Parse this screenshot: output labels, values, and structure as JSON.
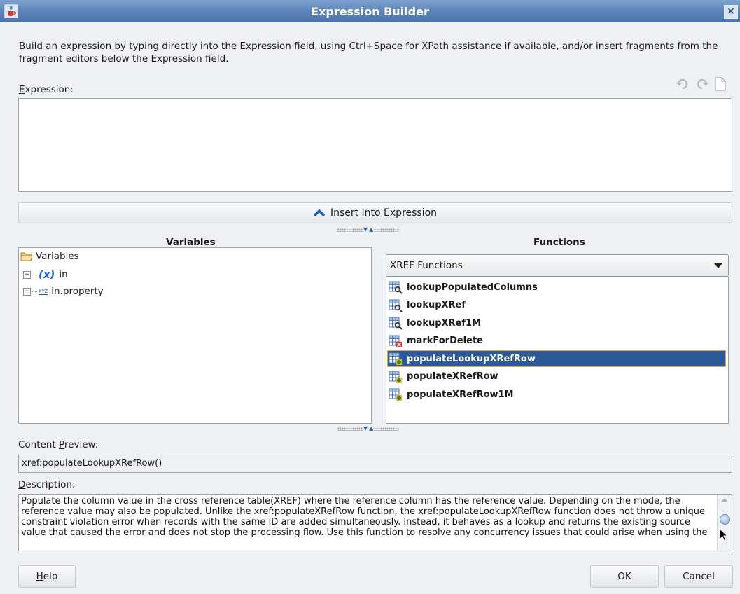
{
  "window": {
    "title": "Expression Builder",
    "close_glyph": "×",
    "app_icon": "java-cup-icon"
  },
  "instructions": "Build an expression by typing directly into the Expression field, using Ctrl+Space for XPath assistance if available, and/or insert fragments from the fragment editors below the Expression field.",
  "expression": {
    "label_mnemonic": "E",
    "label_rest": "xpression:",
    "value": "",
    "tools": [
      "undo-icon",
      "redo-icon",
      "clear-icon"
    ]
  },
  "insert_button": {
    "label": "Insert Into Expression",
    "icon": "chevron-up-icon"
  },
  "variables": {
    "heading": "Variables",
    "tree": [
      {
        "label": "Variables",
        "icon": "folder-icon"
      },
      {
        "label": "in",
        "icon_text": "(x)"
      },
      {
        "label": "in.property",
        "icon_text": "XYZ"
      }
    ]
  },
  "functions": {
    "heading": "Functions",
    "category": "XREF Functions",
    "items": [
      {
        "label": "lookupPopulatedColumns"
      },
      {
        "label": "lookupXRef"
      },
      {
        "label": "lookupXRef1M"
      },
      {
        "label": "markForDelete"
      },
      {
        "label": "populateLookupXRefRow",
        "selected": true
      },
      {
        "label": "populateXRefRow"
      },
      {
        "label": "populateXRefRow1M"
      }
    ]
  },
  "content_preview": {
    "label_before": "Content ",
    "label_mnemonic": "P",
    "label_rest": "review:",
    "value": "xref:populateLookupXRefRow()"
  },
  "description": {
    "label_mnemonic": "D",
    "label_rest": "escription:",
    "text": "Populate the column value in the cross reference table(XREF) where the reference column has the reference value. Depending on the mode, the reference value may also be populated. Unlike the xref:populateXRefRow function, the xref:populateLookupXRefRow function does not throw a unique constraint violation error when records with the same ID are added simultaneously. Instead, it behaves as a lookup and returns the existing source value that caused the error and does not stop the processing flow. Use this function to resolve any concurrency issues that could arise when using the"
  },
  "buttons": {
    "help_mnemonic": "H",
    "help_rest": "elp",
    "ok": "OK",
    "cancel": "Cancel"
  },
  "colors": {
    "titlebar": "#5a82b8",
    "selection": "#2d5a96",
    "selection_outline": "#e6a33e",
    "insert_arrow": "#2b63b0"
  }
}
